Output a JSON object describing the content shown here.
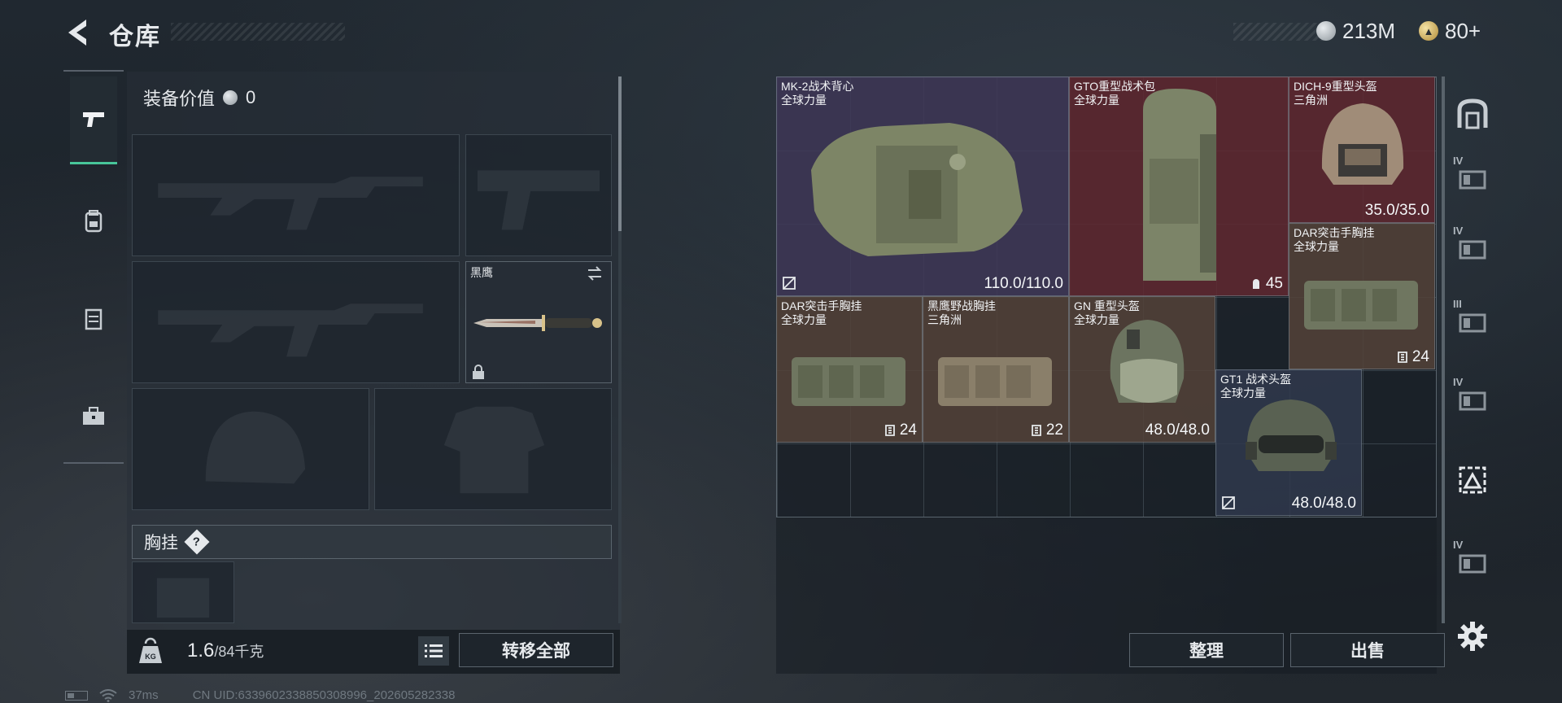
{
  "header": {
    "title": "仓库",
    "currencies": [
      {
        "icon": "silver-coin-icon",
        "value": "213M"
      },
      {
        "icon": "gold-coin-icon",
        "value": "80+"
      }
    ]
  },
  "left_tabs": [
    {
      "icon": "pistol-icon",
      "active": true
    },
    {
      "icon": "backpack-icon",
      "active": false
    },
    {
      "icon": "chest-rig-icon",
      "active": false
    },
    {
      "icon": "toolbox-icon",
      "active": false
    }
  ],
  "equipment": {
    "value_label": "装备价值",
    "value": "0",
    "melee_name": "黑鹰",
    "chestrig_label": "胸挂",
    "help_glyph": "?",
    "weight_current": "1.6",
    "weight_max": "/84千克",
    "transfer_all": "转移全部"
  },
  "stash_items": [
    {
      "id": "vest",
      "name": "MK-2战术背心",
      "faction": "全球力量",
      "value": "110.0/110.0",
      "bg": "#403858",
      "corner_icon": "armor-repair-icon"
    },
    {
      "id": "backpack",
      "name": "GTO重型战术包",
      "faction": "全球力量",
      "value": "45",
      "bg": "#602830",
      "value_icon": "capacity-icon"
    },
    {
      "id": "helmet-dich",
      "name": "DICH-9重型头盔",
      "faction": "三角洲",
      "value": "35.0/35.0",
      "bg": "#602830"
    },
    {
      "id": "rig-dar-top",
      "name": "DAR突击手胸挂",
      "faction": "全球力量",
      "value": "24",
      "bg": "#544238",
      "value_icon": "slots-icon"
    },
    {
      "id": "rig-dar",
      "name": "DAR突击手胸挂",
      "faction": "全球力量",
      "value": "24",
      "bg": "#544238",
      "value_icon": "slots-icon"
    },
    {
      "id": "rig-heiying",
      "name": "黑鹰野战胸挂",
      "faction": "三角洲",
      "value": "22",
      "bg": "#544238",
      "value_icon": "slots-icon"
    },
    {
      "id": "helmet-gn",
      "name": "GN 重型头盔",
      "faction": "全球力量",
      "value": "48.0/48.0",
      "bg": "#544238"
    },
    {
      "id": "helmet-gt1",
      "name": "GT1 战术头盔",
      "faction": "全球力量",
      "value": "48.0/48.0",
      "bg": "#30384c",
      "corner_icon": "armor-repair-icon"
    }
  ],
  "stash_actions": {
    "sort": "整理",
    "sell": "出售"
  },
  "right_rail": [
    {
      "icon": "warehouse-icon",
      "tier": ""
    },
    {
      "icon": "container-icon",
      "tier": "IV"
    },
    {
      "icon": "container-icon",
      "tier": "IV"
    },
    {
      "icon": "container-icon",
      "tier": "III"
    },
    {
      "icon": "container-icon",
      "tier": "IV"
    },
    {
      "icon": "selection-icon",
      "tier": ""
    },
    {
      "icon": "container-icon",
      "tier": "IV"
    }
  ],
  "status_bar": {
    "ping": "37ms",
    "uid": "CN UID:6339602338850308996_202605282338"
  }
}
